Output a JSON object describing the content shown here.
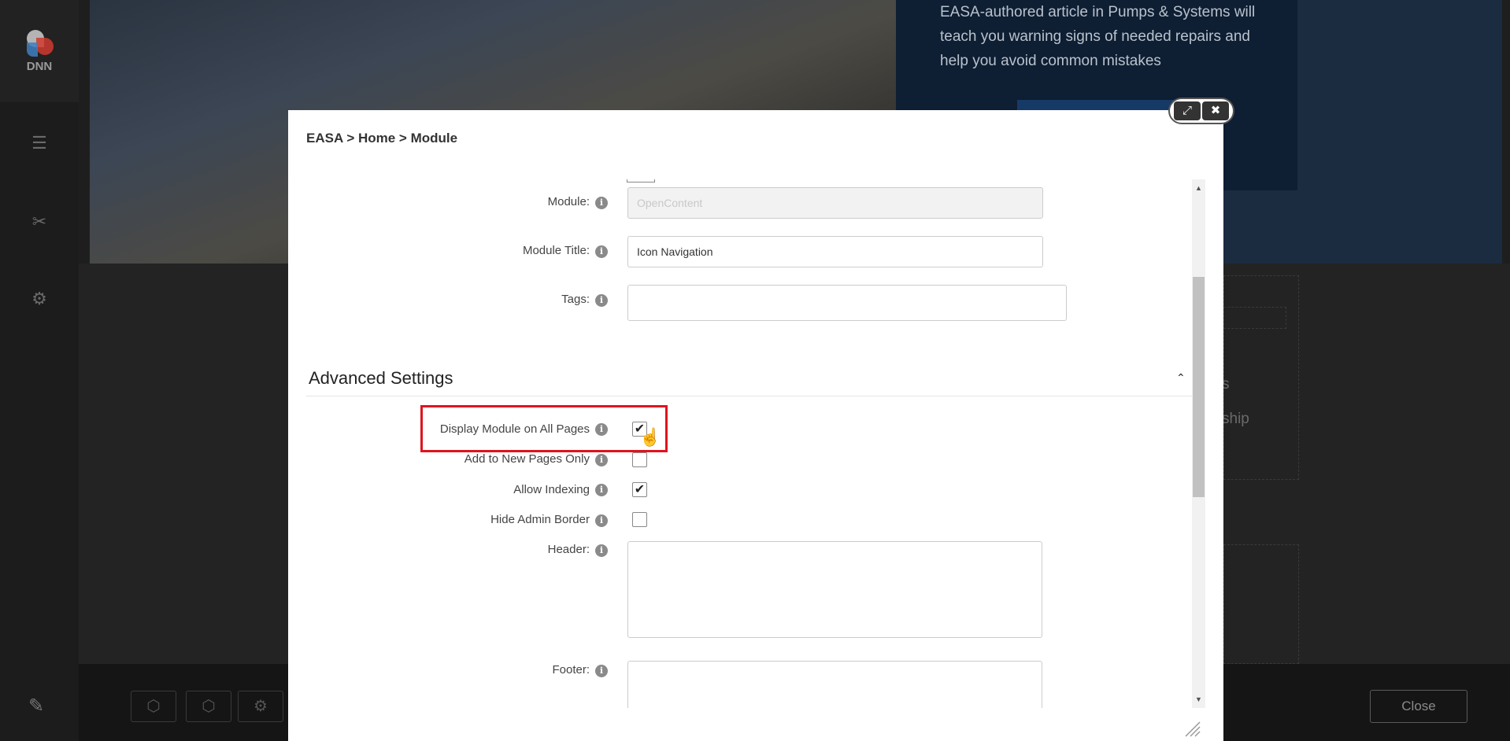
{
  "sidebar": {
    "logo_text": "DNN"
  },
  "background": {
    "hero_text": "EASA-authored article in Pumps & Systems will teach you warning signs of needed repairs and help you avoid common mistakes",
    "side_word_1": "s",
    "side_word_2": "ship"
  },
  "bottom_bar": {
    "close_label": "Close"
  },
  "modal": {
    "breadcrumb": "EASA > Home > Module",
    "fields": {
      "module_label": "Module:",
      "module_value": "OpenContent",
      "module_title_label": "Module Title:",
      "module_title_value": "Icon Navigation",
      "tags_label": "Tags:",
      "tags_value": ""
    },
    "advanced": {
      "title": "Advanced Settings",
      "display_all_pages_label": "Display Module on All Pages",
      "display_all_pages_checked": true,
      "new_pages_only_label": "Add to New Pages Only",
      "new_pages_only_checked": false,
      "allow_indexing_label": "Allow Indexing",
      "allow_indexing_checked": true,
      "hide_admin_border_label": "Hide Admin Border",
      "hide_admin_border_checked": false,
      "header_label": "Header:",
      "header_value": "",
      "footer_label": "Footer:",
      "footer_value": ""
    },
    "info_glyph": "i",
    "check_glyph": "✔",
    "toggle_glyph": "⌃",
    "expand_glyph": "⤢",
    "close_glyph": "✖"
  },
  "colors": {
    "highlight": "#e0141e"
  }
}
